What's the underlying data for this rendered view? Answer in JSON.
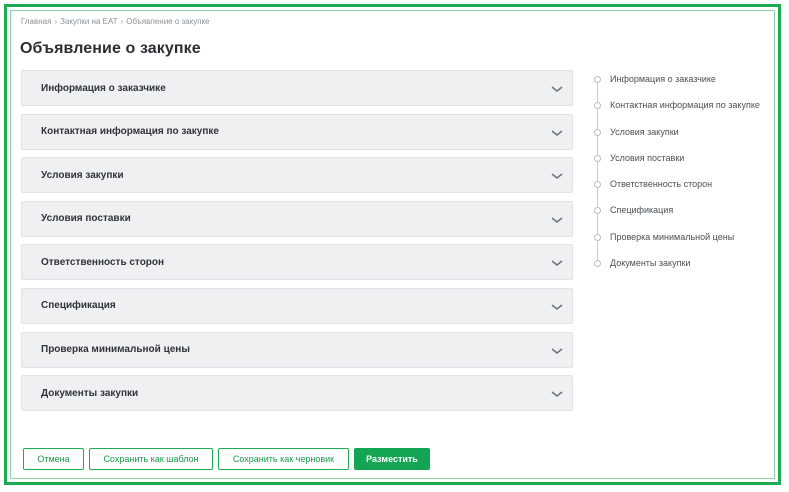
{
  "breadcrumb": {
    "items": [
      "Главная",
      "Закупки на ЕАТ",
      "Объявление о закупке"
    ],
    "separator": "›"
  },
  "page": {
    "title": "Объявление о закупке"
  },
  "sections": [
    {
      "label": "Информация о заказчике"
    },
    {
      "label": "Контактная информация по закупке"
    },
    {
      "label": "Условия закупки"
    },
    {
      "label": "Условия поставки"
    },
    {
      "label": "Ответственность сторон"
    },
    {
      "label": "Спецификация"
    },
    {
      "label": "Проверка минимальной цены"
    },
    {
      "label": "Документы закупки"
    }
  ],
  "toc": [
    "Информация о заказчике",
    "Контактная информация по закупке",
    "Условия закупки",
    "Условия поставки",
    "Ответственность сторон",
    "Спецификация",
    "Проверка минимальной цены",
    "Документы закупки"
  ],
  "actions": {
    "cancel": "Отмена",
    "save_template": "Сохранить как шаблон",
    "save_draft": "Сохранить как черновик",
    "publish": "Разместить"
  },
  "icons": {
    "section_chevron": "chevron-down-icon",
    "toc_marker": "circle-icon"
  },
  "colors": {
    "accent": "#13a454",
    "frame": "#1faa54",
    "section_bg": "#eef0f2"
  }
}
